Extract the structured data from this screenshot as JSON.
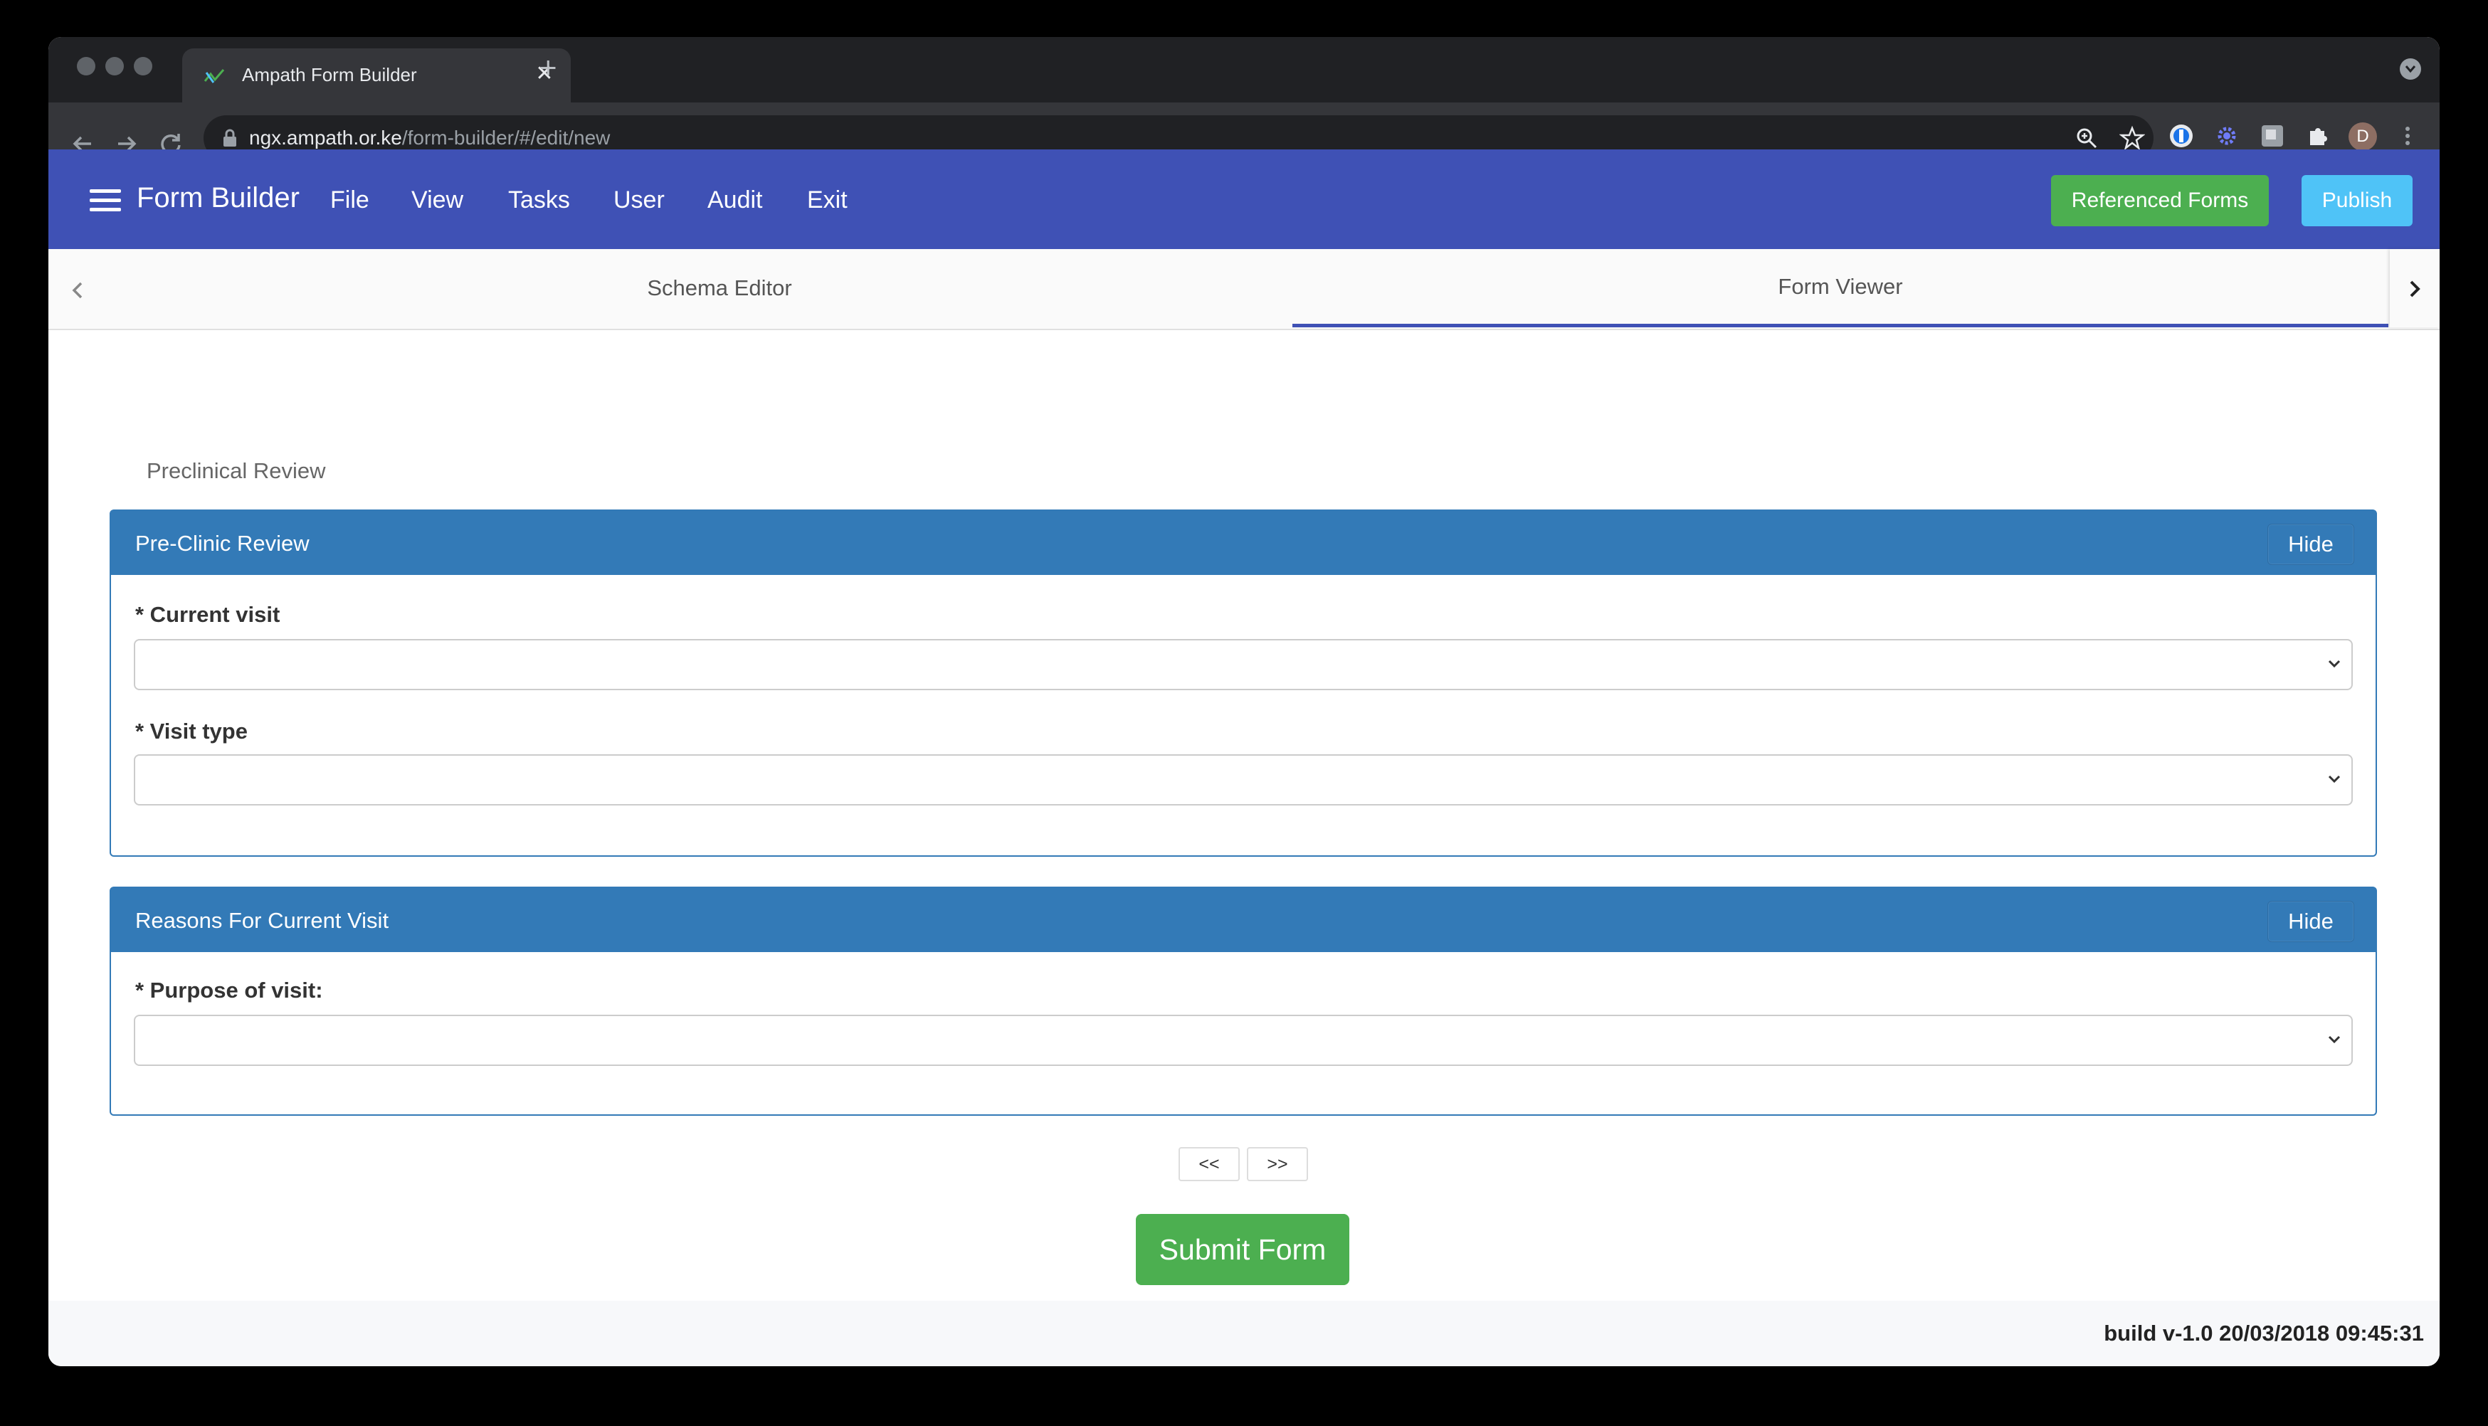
{
  "browser": {
    "tab_title": "Ampath Form Builder",
    "url_host": "ngx.ampath.or.ke",
    "url_path": "/form-builder/#/edit/new",
    "profile_initial": "D"
  },
  "app": {
    "brand": "Form Builder",
    "menu": [
      "File",
      "View",
      "Tasks",
      "User",
      "Audit",
      "Exit"
    ],
    "referenced_forms_label": "Referenced Forms",
    "publish_label": "Publish",
    "colors": {
      "header": "#3f51b5",
      "success": "#4caf50",
      "info": "#4fc3f7",
      "panel": "#337ab7"
    }
  },
  "tabs": [
    {
      "label": "Schema Editor",
      "active": false
    },
    {
      "label": "Form Viewer",
      "active": true
    }
  ],
  "form": {
    "page_title": "Preclinical Review",
    "sections": [
      {
        "title": "Pre-Clinic Review",
        "hide_label": "Hide",
        "fields": [
          {
            "label": "* Current visit",
            "value": ""
          },
          {
            "label": "* Visit type",
            "value": ""
          }
        ]
      },
      {
        "title": "Reasons For Current Visit",
        "hide_label": "Hide",
        "fields": [
          {
            "label": "* Purpose of visit:",
            "value": ""
          }
        ]
      }
    ],
    "prev_label": "<<",
    "next_label": ">>",
    "submit_label": "Submit Form"
  },
  "footer": {
    "build": "build v-1.0 20/03/2018 09:45:31"
  }
}
